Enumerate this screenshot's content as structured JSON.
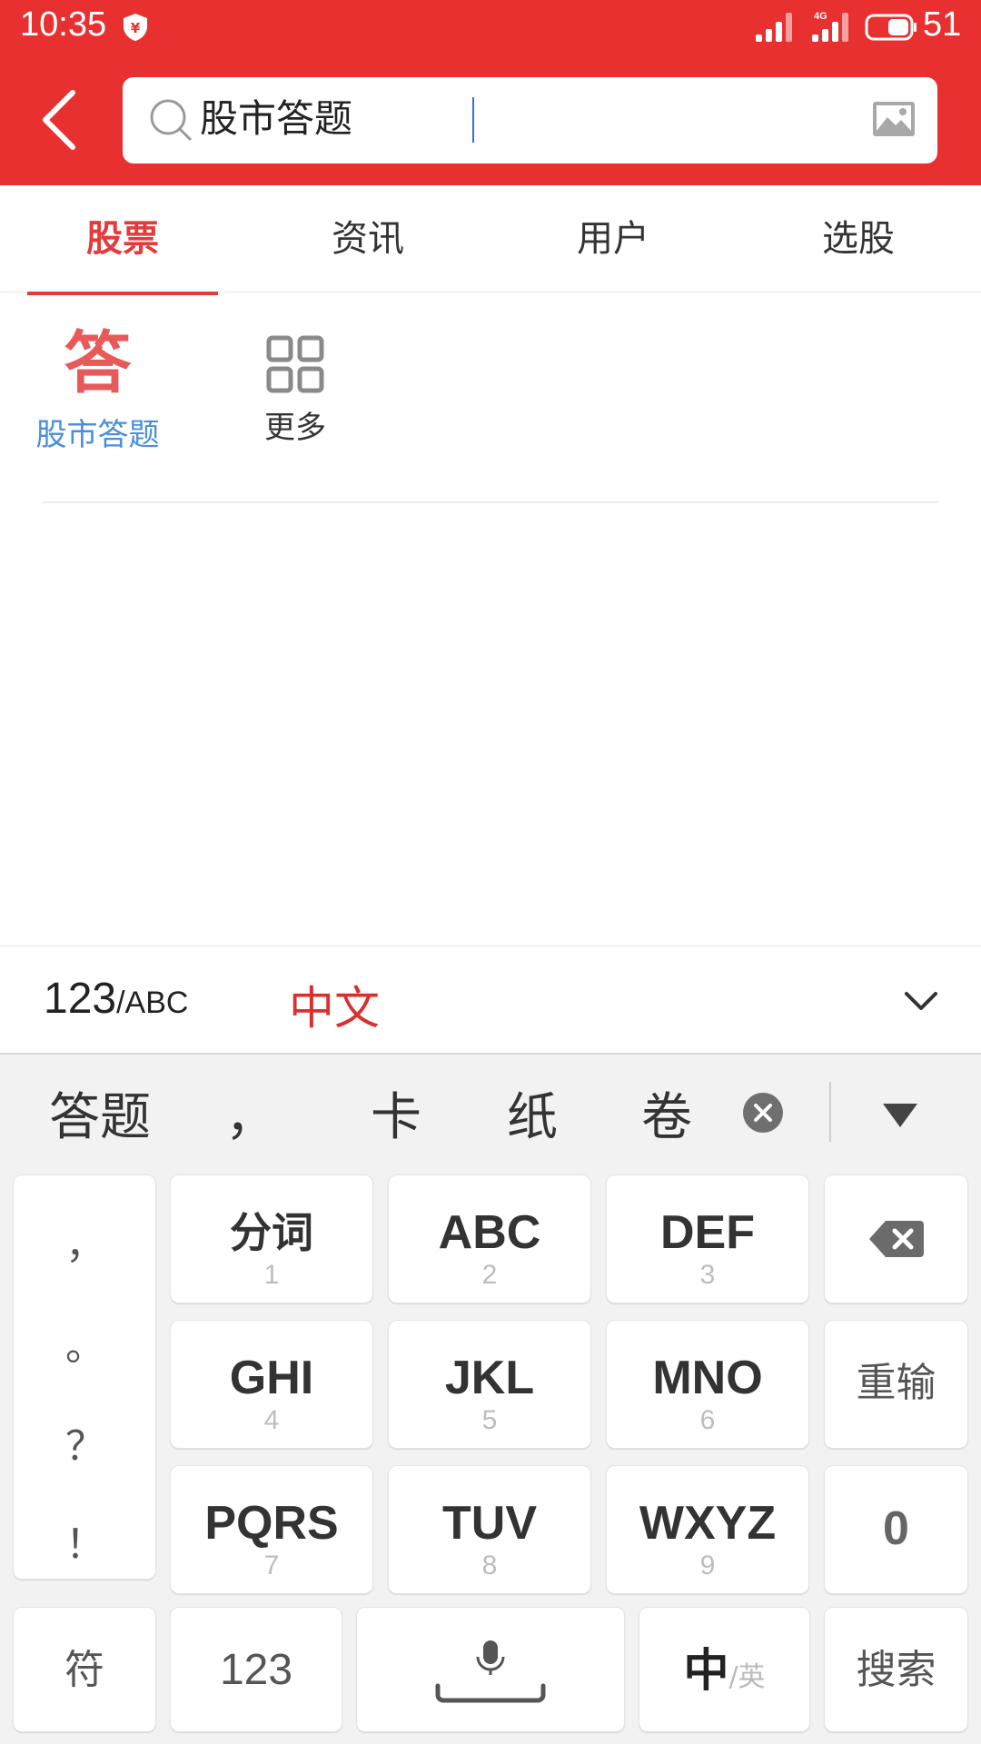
{
  "status_bar": {
    "time": "10:35",
    "battery": "51",
    "network": "4G"
  },
  "search": {
    "query": "股市答题"
  },
  "tabs": [
    {
      "label": "股票",
      "active": true
    },
    {
      "label": "资讯",
      "active": false
    },
    {
      "label": "用户",
      "active": false
    },
    {
      "label": "选股",
      "active": false
    }
  ],
  "quick_items": [
    {
      "glyph": "答",
      "label": "股市答题"
    },
    {
      "label": "更多"
    }
  ],
  "keyboard": {
    "mode_123": "123",
    "mode_abc": "/ABC",
    "mode_cn": "中文",
    "candidates": [
      "答题",
      "，",
      "卡",
      "纸",
      "卷"
    ],
    "punctuation": [
      "，",
      "。",
      "？",
      "！"
    ],
    "keys": [
      {
        "main": "分词",
        "sub": "1"
      },
      {
        "main": "ABC",
        "sub": "2"
      },
      {
        "main": "DEF",
        "sub": "3"
      },
      {
        "main": "GHI",
        "sub": "4"
      },
      {
        "main": "JKL",
        "sub": "5"
      },
      {
        "main": "MNO",
        "sub": "6"
      },
      {
        "main": "PQRS",
        "sub": "7"
      },
      {
        "main": "TUV",
        "sub": "8"
      },
      {
        "main": "WXYZ",
        "sub": "9"
      }
    ],
    "reenter": "重输",
    "zero": "0",
    "symbols": "符",
    "num": "123",
    "lang_cn": "中",
    "lang_sep": "/",
    "lang_en": "英",
    "search": "搜索"
  },
  "colors": {
    "brand_red": "#e93030",
    "accent_red": "#e33b3b",
    "link_blue": "#4a8fdc"
  }
}
